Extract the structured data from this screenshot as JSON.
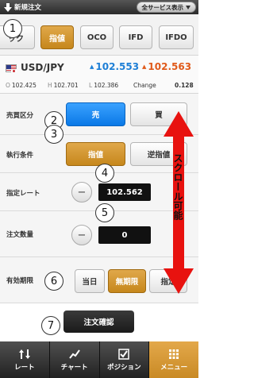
{
  "titlebar": {
    "title": "新規注文",
    "service_button": "全サービス表示"
  },
  "order_types": [
    {
      "label": "ック",
      "selected": false
    },
    {
      "label": "指値",
      "selected": true
    },
    {
      "label": "OCO",
      "selected": false
    },
    {
      "label": "IFD",
      "selected": false
    },
    {
      "label": "IFDO",
      "selected": false
    }
  ],
  "quote": {
    "symbol": "USD/JPY",
    "bid": "102.553",
    "ask": "102.563",
    "open_label": "O",
    "open": "102.425",
    "high_label": "H",
    "high": "102.701",
    "low_label": "L",
    "low": "102.386",
    "change_label": "Change",
    "change": "0.128"
  },
  "side": {
    "label": "売買区分",
    "sell": "売",
    "buy": "買",
    "selected": "sell"
  },
  "exec": {
    "label": "執行条件",
    "limit": "指値",
    "stop": "逆指値",
    "selected": "limit"
  },
  "price": {
    "label": "指定レート",
    "minus": "−",
    "value": "102.562"
  },
  "qty": {
    "label": "注文数量",
    "minus": "−",
    "value": "0"
  },
  "expiry": {
    "label": "有効期限",
    "day": "当日",
    "gtc": "無期限",
    "specified": "指定",
    "selected": "gtc"
  },
  "confirm_label": "注文確認",
  "scroll_note": "スクロール可能",
  "callouts": [
    "1",
    "2",
    "3",
    "4",
    "5",
    "6",
    "7"
  ],
  "tabs": [
    {
      "label": "レート",
      "icon": "rate-arrows-icon",
      "active": false
    },
    {
      "label": "チャート",
      "icon": "chart-icon",
      "active": false
    },
    {
      "label": "ポジション",
      "icon": "position-checkbox-icon",
      "active": false
    },
    {
      "label": "メニュー",
      "icon": "menu-grid-icon",
      "active": true
    }
  ],
  "colors": {
    "accent_gold": "#c6871c",
    "sell_blue": "#0a78e6",
    "bid_blue": "#1e7fd6",
    "ask_orange": "#e05a1a",
    "scroll_arrow_red": "#e8120f"
  }
}
